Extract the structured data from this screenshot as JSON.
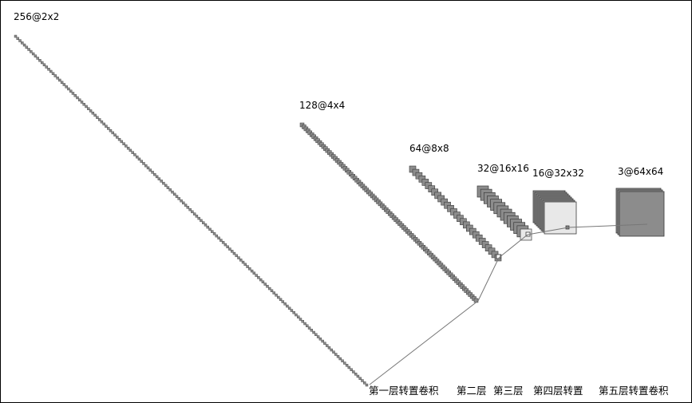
{
  "layers": [
    {
      "id": "l1",
      "label": "256@2x2"
    },
    {
      "id": "l2",
      "label": "128@4x4"
    },
    {
      "id": "l3",
      "label": "64@8x8"
    },
    {
      "id": "l4",
      "label": "32@16x16"
    },
    {
      "id": "l5",
      "label": "16@32x32"
    },
    {
      "id": "l6",
      "label": "3@64x64"
    }
  ],
  "captions": [
    "第一层转置卷积",
    "第二层",
    "第三层",
    "第四层转置",
    "第五层转置卷积"
  ],
  "colors": {
    "map_fill": "#8c8c8c",
    "map_stroke": "#3a3a3a",
    "connector": "#777777",
    "target_fill": "#e8e8e8"
  }
}
